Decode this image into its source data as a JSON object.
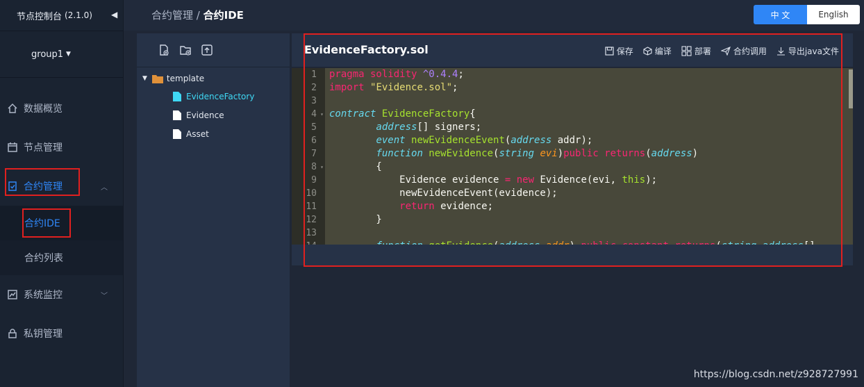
{
  "app": {
    "title": "节点控制台",
    "version": "(2.1.0)",
    "group": "group1"
  },
  "sidebar": {
    "items": [
      {
        "label": "数据概览"
      },
      {
        "label": "节点管理"
      },
      {
        "label": "合约管理"
      },
      {
        "label": "系统监控"
      },
      {
        "label": "私钥管理"
      }
    ],
    "contract_sub": [
      {
        "label": "合约IDE"
      },
      {
        "label": "合约列表"
      }
    ]
  },
  "breadcrumb": {
    "parent": "合约管理",
    "sep": "/",
    "current": "合约IDE"
  },
  "lang": {
    "zh": "中 文",
    "en": "English"
  },
  "tree": {
    "folder": "template",
    "files": [
      "EvidenceFactory",
      "Evidence",
      "Asset"
    ]
  },
  "editor": {
    "filename": "EvidenceFactory.sol",
    "actions": {
      "save": "保存",
      "compile": "编译",
      "deploy": "部署",
      "call": "合约调用",
      "export": "导出java文件"
    },
    "line_numbers": [
      "1",
      "2",
      "3",
      "4",
      "5",
      "6",
      "7",
      "8",
      "9",
      "10",
      "11",
      "12",
      "13",
      "14"
    ]
  },
  "watermark": "https://blog.csdn.net/z928727991",
  "colors": {
    "accent": "#2f86f6",
    "highlight": "#e0201f",
    "selected_file": "#3fd9f5"
  }
}
